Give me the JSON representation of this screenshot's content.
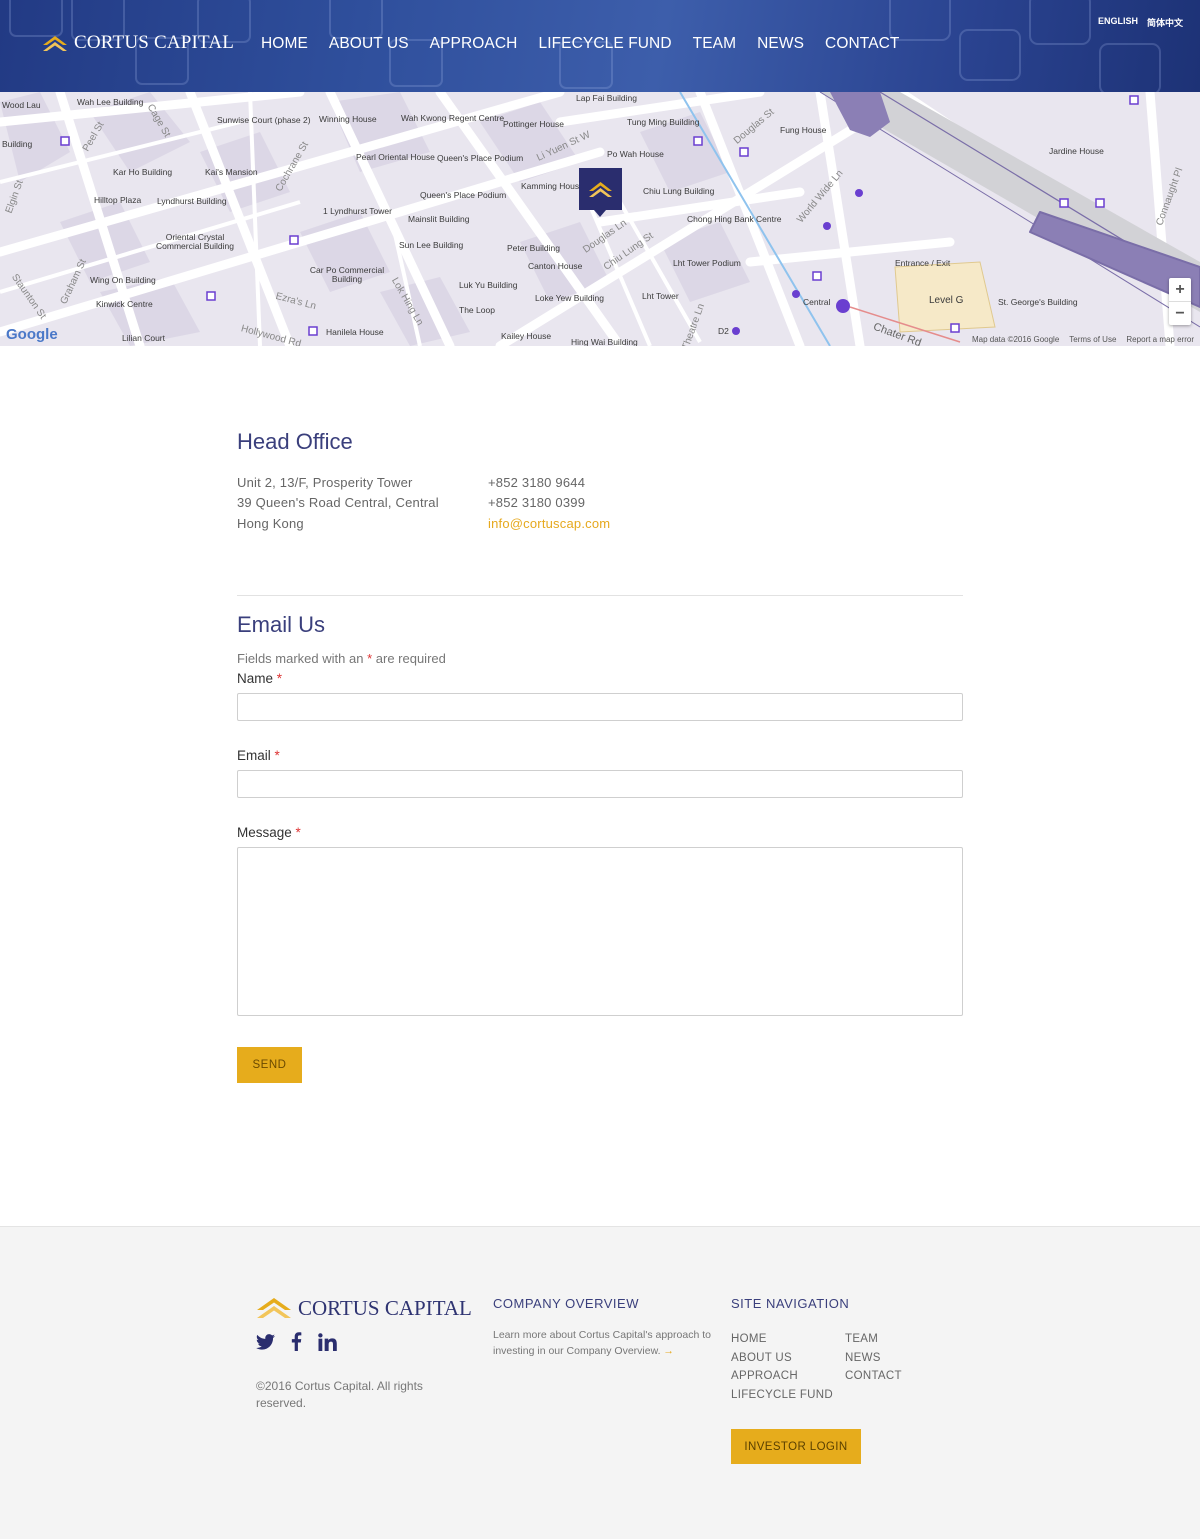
{
  "header": {
    "brand": "CORTUS CAPITAL",
    "nav": [
      "HOME",
      "ABOUT US",
      "APPROACH",
      "LIFECYCLE FUND",
      "TEAM",
      "NEWS",
      "CONTACT"
    ],
    "languages": [
      "ENGLISH",
      "简体中文"
    ]
  },
  "map": {
    "labels": [
      "Wood Lau",
      "Wah Lee Building",
      "Sunwise Court (phase 2)",
      "Winning House",
      "Wah Kwong Regent Centre",
      "Pottinger House",
      "Lap Fai Building",
      "Tung Ming Building",
      "Fung House",
      "Jardine House",
      "Building",
      "Kar Ho Building",
      "Kai's Mansion",
      "Pearl Oriental House",
      "Queen's Place Podium",
      "Po Wah House",
      "Hilltop Plaza",
      "Lyndhurst Building",
      "1 Lyndhurst Tower",
      "Queen's Place Podium",
      "Kamming House",
      "Chiu Lung Building",
      "Mainslit Building",
      "Chong Hing Bank Centre",
      "Oriental Crystal Commercial Building",
      "Sun Lee Building",
      "Peter Building",
      "Canton House",
      "Lht Tower Podium",
      "Entrance / Exit",
      "Car Po Commercial Building",
      "Wing On Building",
      "Luk Yu Building",
      "Loke Yew Building",
      "Lht Tower",
      "Central",
      "Level G",
      "St. George's Building",
      "Kinwick Centre",
      "The Loop",
      "Lilian Court",
      "Hanilela House",
      "Kailey House",
      "Hing Wai Building",
      "D2"
    ],
    "street_labels": [
      "Peel St",
      "Cage St",
      "Elgin St",
      "Graham St",
      "Staunton St",
      "Cochrane St",
      "Li Yuen St W",
      "Douglas Ln",
      "Chiu Lung St",
      "Theatre Ln",
      "World Wide Ln",
      "Connaught Pl",
      "Douglas St",
      "Ezra's Ln",
      "Lok Hing Ln",
      "Hollywood Rd",
      "Chater Rd"
    ],
    "google": "Google",
    "attribution": [
      "Map data ©2016 Google",
      "Terms of Use",
      "Report a map error"
    ],
    "zoom_in": "+",
    "zoom_out": "−"
  },
  "head_office": {
    "title": "Head Office",
    "address": [
      "Unit 2, 13/F, Prosperity Tower",
      "39 Queen's Road Central, Central",
      "Hong Kong"
    ],
    "phone1": "+852 3180 9644",
    "phone2": "+852 3180 0399",
    "email": "info@cortuscap.com"
  },
  "form": {
    "title": "Email Us",
    "note_prefix": "Fields marked with an",
    "note_star": "*",
    "note_suffix": "are required",
    "name_label": "Name",
    "email_label": "Email",
    "message_label": "Message",
    "required_mark": "*",
    "send_label": "SEND"
  },
  "footer": {
    "brand_main": "CORTUS",
    "brand_sub": "CAPITAL",
    "social": {
      "twitter": "twitter-icon",
      "facebook": "facebook-icon",
      "linkedin": "linkedin-icon"
    },
    "copyright": "©2016 Cortus Capital. All rights reserved.",
    "overview_title": "COMPANY OVERVIEW",
    "overview_text": "Learn more about Cortus Capital's approach to investing in our Company Overview.",
    "overview_arrow": "→",
    "nav_title": "SITE NAVIGATION",
    "nav_col1": [
      "HOME",
      "ABOUT US",
      "APPROACH",
      "LIFECYCLE FUND"
    ],
    "nav_col2": [
      "TEAM",
      "NEWS",
      "CONTACT"
    ],
    "login_label": "INVESTOR LOGIN"
  },
  "colors": {
    "brand_navy": "#2a2d6e",
    "accent_gold": "#e6ac1c",
    "title_blue": "#3a3f7c"
  }
}
